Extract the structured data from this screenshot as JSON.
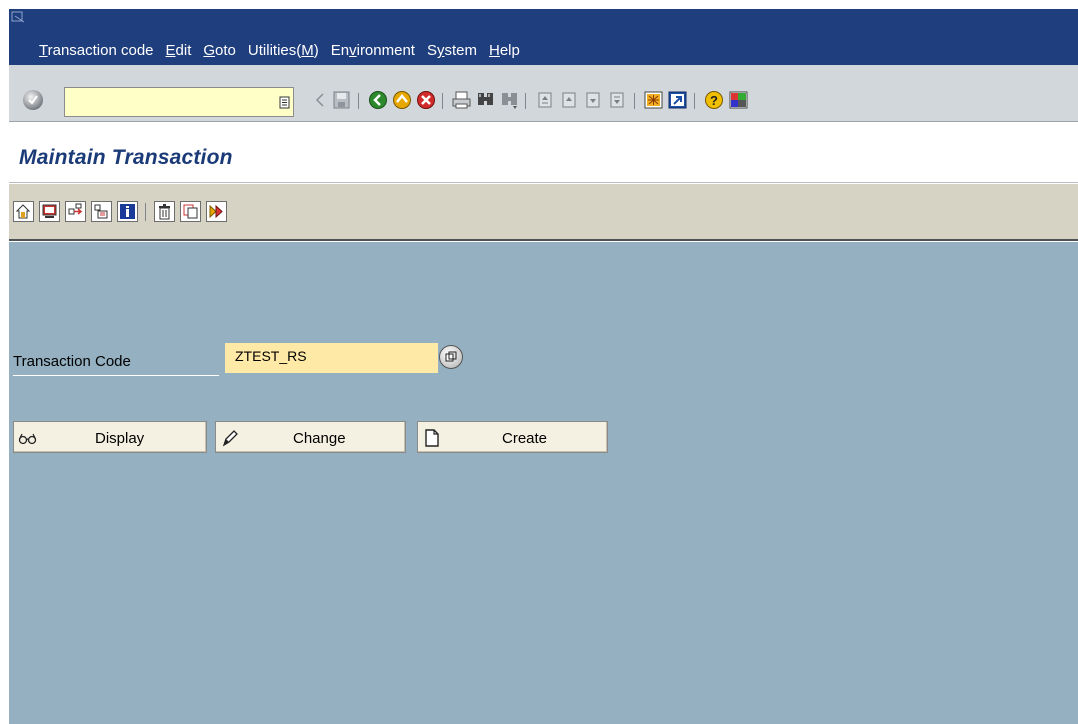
{
  "menu": {
    "items": [
      {
        "label": "Transaction code",
        "accel": "T"
      },
      {
        "label": "Edit",
        "accel": "E"
      },
      {
        "label": "Goto",
        "accel": "G"
      },
      {
        "label": "Utilities(M)",
        "accel": "M"
      },
      {
        "label": "Environment",
        "accel": "v"
      },
      {
        "label": "System",
        "accel": "y"
      },
      {
        "label": "Help",
        "accel": "H"
      }
    ]
  },
  "std_toolbar": {
    "command_field_value": "",
    "icons": [
      "enter-icon",
      "command-history-icon",
      "back-arrow-icon",
      "save-icon",
      "back-icon",
      "exit-icon",
      "cancel-icon",
      "print-icon",
      "find-icon",
      "find-next-icon",
      "first-page-icon",
      "previous-page-icon",
      "next-page-icon",
      "last-page-icon",
      "create-session-icon",
      "shortcut-icon",
      "help-icon",
      "layout-menu-icon"
    ]
  },
  "screen": {
    "title": "Maintain Transaction"
  },
  "app_toolbar": {
    "icons": [
      "other-object-icon",
      "display-change-icon",
      "where-used-icon",
      "object-list-icon",
      "information-icon",
      "delete-icon",
      "copy-icon",
      "transport-icon"
    ]
  },
  "form": {
    "field_label": "Transaction Code",
    "transaction_code": "ZTEST_RS",
    "buttons": {
      "display": "Display",
      "change": "Change",
      "create": "Create"
    }
  },
  "colors": {
    "menubar": "#1f3e7d",
    "std_toolbar": "#d2d7db",
    "title_text": "#1a3a78",
    "app_toolbar": "#d6d3c4",
    "content_bg": "#94b0c1",
    "input_bg": "#ffe9a6",
    "command_bg": "#ffffc8",
    "button_bg": "#f5f1e2"
  }
}
